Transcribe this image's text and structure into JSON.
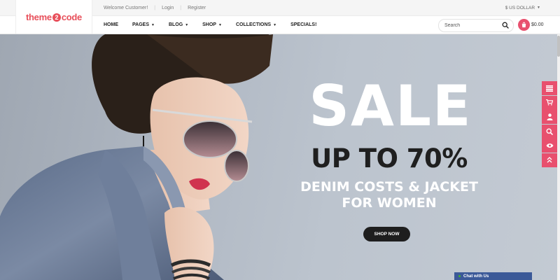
{
  "header": {
    "logo": {
      "part1": "theme",
      "part2": "2",
      "part3": "code"
    },
    "top_links": {
      "welcome": "Welcome Customer!",
      "login": "Login",
      "register": "Register"
    },
    "currency": "$ US DOLLAR",
    "nav": [
      {
        "label": "HOME",
        "dropdown": false
      },
      {
        "label": "PAGES",
        "dropdown": true
      },
      {
        "label": "BLOG",
        "dropdown": true
      },
      {
        "label": "SHOP",
        "dropdown": true
      },
      {
        "label": "COLLECTIONS",
        "dropdown": true
      },
      {
        "label": "SPECIALS!",
        "dropdown": false
      }
    ],
    "search": {
      "placeholder": "Search",
      "value": ""
    },
    "cart": {
      "total": "$0.00"
    }
  },
  "hero": {
    "headline": "SALE",
    "subline": "UP TO 70%",
    "desc_line1": "DENIM COSTS & JACKET",
    "desc_line2": "FOR WOMEN",
    "button": "SHOP NOW"
  },
  "side_tools": [
    "list-icon",
    "cart-icon",
    "user-icon",
    "search-icon",
    "eye-icon",
    "chevrons-up-icon"
  ],
  "chat": {
    "label": "Chat with Us"
  },
  "colors": {
    "accent": "#e8506e",
    "logo": "#e8505b",
    "button": "#1e1e1e",
    "chat": "#3b5998"
  }
}
